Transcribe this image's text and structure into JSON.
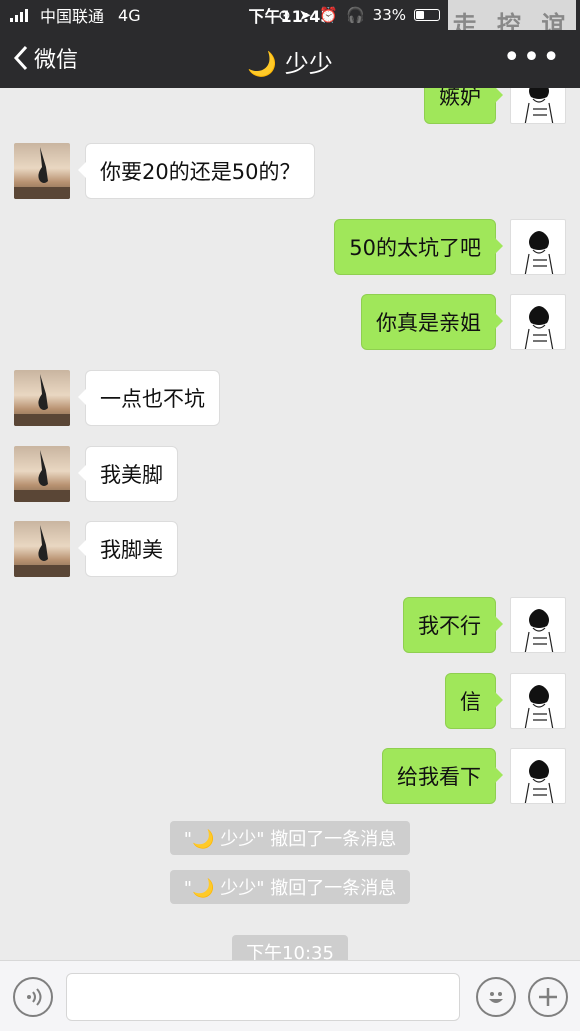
{
  "status_bar": {
    "carrier": "中国联通",
    "network": "4G",
    "time": "下午11:43",
    "battery_text": "33%",
    "watermark": "走 控 谊"
  },
  "nav": {
    "back_label": "微信",
    "title": "🌙 少少",
    "more": "•••"
  },
  "messages": [
    {
      "side": "right",
      "text": "嫉妒"
    },
    {
      "side": "left",
      "text": "你要20的还是50的？"
    },
    {
      "side": "right",
      "text": "50的太坑了吧"
    },
    {
      "side": "right",
      "text": "你真是亲姐"
    },
    {
      "side": "left",
      "text": "一点也不坑"
    },
    {
      "side": "left",
      "text": "我美脚"
    },
    {
      "side": "left",
      "text": "我脚美"
    },
    {
      "side": "right",
      "text": "我不行"
    },
    {
      "side": "right",
      "text": "信"
    },
    {
      "side": "right",
      "text": "给我看下"
    }
  ],
  "system_notices": [
    "\"🌙 少少\" 撤回了一条消息",
    "\"🌙 少少\" 撤回了一条消息"
  ],
  "timestamp": "下午10:35",
  "colors": {
    "bar": "#2b2b2d",
    "bubble_green": "#a0e75a",
    "bubble_white": "#ffffff",
    "chat_bg": "#ebebeb"
  }
}
